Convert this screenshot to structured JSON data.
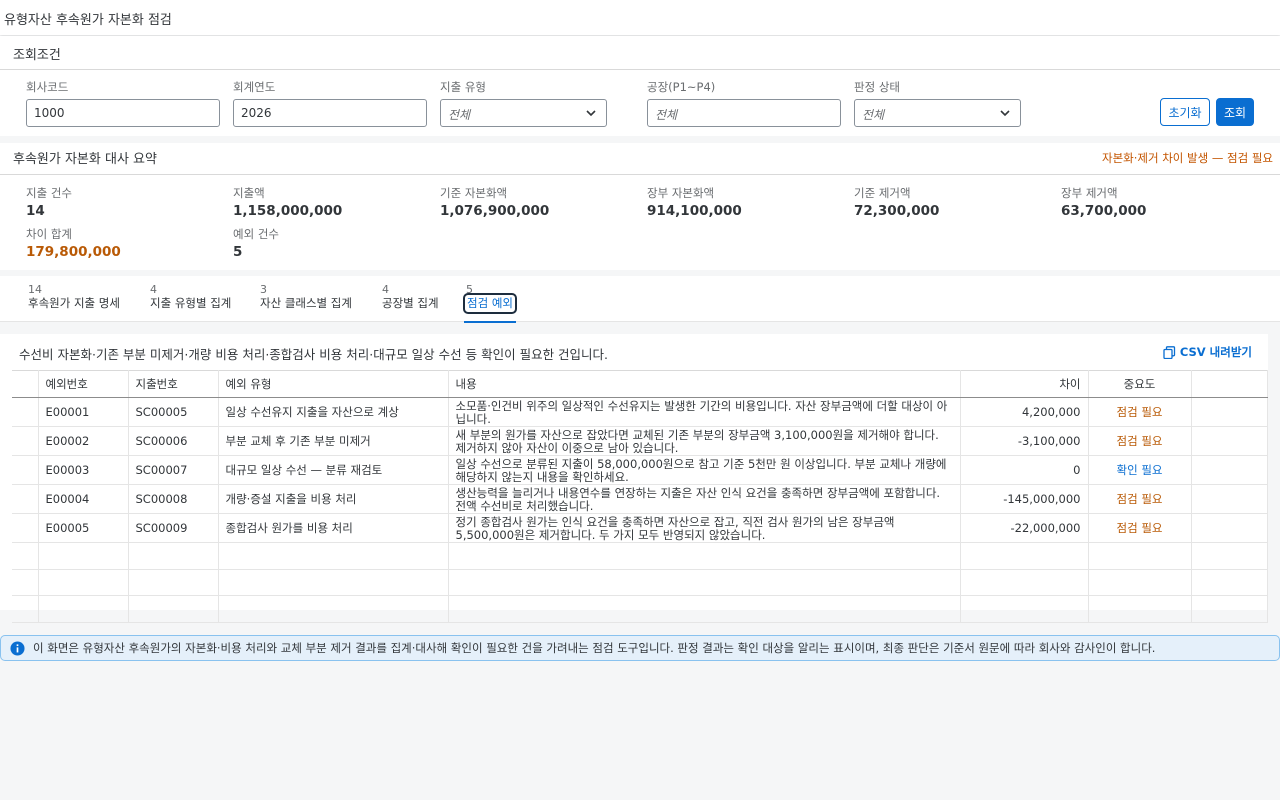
{
  "app": {
    "title": "유형자산 후속원가 자본화 점검"
  },
  "filters": {
    "section_title": "조회조건",
    "company_code": {
      "label": "회사코드",
      "value": "1000"
    },
    "fiscal_year": {
      "label": "회계연도",
      "value": "2026"
    },
    "expense_type": {
      "label": "지출 유형",
      "value": "전체"
    },
    "plant": {
      "label": "공장(P1~P4)",
      "placeholder": "전체"
    },
    "judgement": {
      "label": "판정 상태",
      "value": "전체"
    },
    "reset_label": "초기화",
    "search_label": "조회"
  },
  "summary": {
    "section_title": "후속원가 자본화 대사 요약",
    "warning": "자본화·제거 차이 발생 — 점검 필요",
    "kpis": [
      {
        "label": "지출 건수",
        "value": "14"
      },
      {
        "label": "지출액",
        "value": "1,158,000,000"
      },
      {
        "label": "기준 자본화액",
        "value": "1,076,900,000"
      },
      {
        "label": "장부 자본화액",
        "value": "914,100,000"
      },
      {
        "label": "기준 제거액",
        "value": "72,300,000"
      },
      {
        "label": "장부 제거액",
        "value": "63,700,000"
      },
      {
        "label": "차이 합계",
        "value": "179,800,000"
      },
      {
        "label": "예외 건수",
        "value": "5"
      }
    ]
  },
  "tabs": [
    {
      "count": "14",
      "label": "후속원가 지출 명세"
    },
    {
      "count": "4",
      "label": "지출 유형별 집계"
    },
    {
      "count": "3",
      "label": "자산 클래스별 집계"
    },
    {
      "count": "4",
      "label": "공장별 집계"
    },
    {
      "count": "5",
      "label": "점검 예외"
    }
  ],
  "exceptions": {
    "description": "수선비 자본화·기존 부분 미제거·개량 비용 처리·종합검사 비용 처리·대규모 일상 수선 등 확인이 필요한 건입니다.",
    "csv_label": "CSV 내려받기",
    "columns": [
      "예외번호",
      "지출번호",
      "예외 유형",
      "내용",
      "차이",
      "중요도"
    ],
    "rows": [
      {
        "id": "E00001",
        "expense": "SC00005",
        "type": "일상 수선유지 지출을 자산으로 계상",
        "content": "소모품·인건비 위주의 일상적인 수선유지는 발생한 기간의 비용입니다. 자산 장부금액에 더할 대상이 아닙니다.",
        "diff": "4,200,000",
        "severity": "점검 필요"
      },
      {
        "id": "E00002",
        "expense": "SC00006",
        "type": "부분 교체 후 기존 부분 미제거",
        "content": "새 부분의 원가를 자산으로 잡았다면 교체된 기존 부분의 장부금액 3,100,000원을 제거해야 합니다. 제거하지 않아 자산이 이중으로 남아 있습니다.",
        "diff": "-3,100,000",
        "severity": "점검 필요"
      },
      {
        "id": "E00003",
        "expense": "SC00007",
        "type": "대규모 일상 수선 — 분류 재검토",
        "content": "일상 수선으로 분류된 지출이 58,000,000원으로 참고 기준 5천만 원 이상입니다. 부분 교체나 개량에 해당하지 않는지 내용을 확인하세요.",
        "diff": "0",
        "severity": "확인 필요"
      },
      {
        "id": "E00004",
        "expense": "SC00008",
        "type": "개량·증설 지출을 비용 처리",
        "content": "생산능력을 늘리거나 내용연수를 연장하는 지출은 자산 인식 요건을 충족하면 장부금액에 포함합니다. 전액 수선비로 처리했습니다.",
        "diff": "-145,000,000",
        "severity": "점검 필요"
      },
      {
        "id": "E00005",
        "expense": "SC00009",
        "type": "종합검사 원가를 비용 처리",
        "content": "정기 종합검사 원가는 인식 요건을 충족하면 자산으로 잡고, 직전 검사 원가의 남은 장부금액 5,500,000원은 제거합니다. 두 가지 모두 반영되지 않았습니다.",
        "diff": "-22,000,000",
        "severity": "점검 필요"
      }
    ]
  },
  "info": "이 화면은 유형자산 후속원가의 자본화·비용 처리와 교체 부분 제거 결과를 집계·대사해 확인이 필요한 건을 가려내는 점검 도구입니다. 판정 결과는 확인 대상을 알리는 표시이며, 최종 판단은 기준서 원문에 따라 회사와 감사인이 합니다.",
  "colors": {
    "accent": "#0a6ed1",
    "warning": "#b95a06",
    "info_bg": "#e5f0fa"
  }
}
